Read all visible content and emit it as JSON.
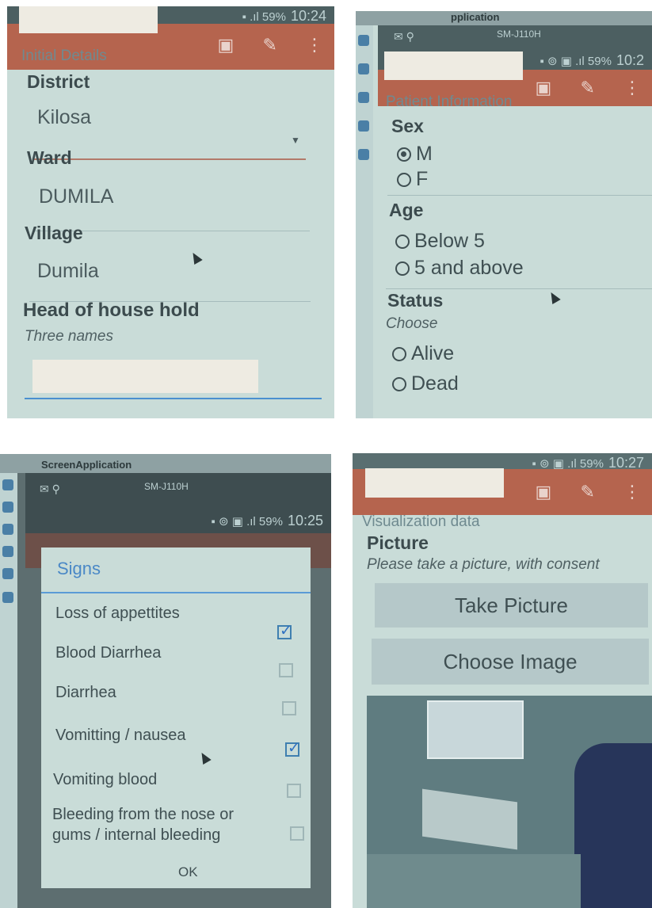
{
  "panel1": {
    "time": "10:24",
    "status_icons": "▪ .ıl 59%",
    "section_title": "Initial Details",
    "district_label": "District",
    "district_value": "Kilosa",
    "ward_label": "Ward",
    "ward_value": "DUMILA",
    "village_label": "Village",
    "village_value": "Dumila",
    "head_label": "Head of house hold",
    "head_hint": "Three names"
  },
  "panel2": {
    "window_title": "pplication",
    "device": "SM-J110H",
    "time": "10:2",
    "status_icons": "▪ ⊚ ▣ .ıl 59%",
    "section_title": "Patient Information",
    "sex_label": "Sex",
    "sex_options": [
      "M",
      "F"
    ],
    "sex_selected": "M",
    "age_label": "Age",
    "age_options": [
      "Below 5",
      "5 and above"
    ],
    "status_label": "Status",
    "status_hint": "Choose",
    "status_options": [
      "Alive",
      "Dead"
    ]
  },
  "panel3": {
    "window_title": "ScreenApplication",
    "device": "SM-J110H",
    "time": "10:25",
    "status_icons": "▪ ⊚ ▣ .ıl 59%",
    "dialog_title": "Signs",
    "items": [
      {
        "label": "Loss of appettites",
        "checked": true
      },
      {
        "label": "Blood Diarrhea",
        "checked": false
      },
      {
        "label": "Diarrhea",
        "checked": false
      },
      {
        "label": "Vomitting / nausea",
        "checked": true
      },
      {
        "label": "Vomiting blood",
        "checked": false
      },
      {
        "label": "Bleeding from the nose or gums / internal bleeding",
        "checked": false
      }
    ],
    "ok_label": "OK"
  },
  "panel4": {
    "time": "10:27",
    "status_icons": "▪ ⊚ ▣ .ıl 59%",
    "section_title": "Visualization data",
    "picture_label": "Picture",
    "picture_hint": "Please take a picture, with consent",
    "take_picture_label": "Take Picture",
    "choose_image_label": "Choose Image"
  },
  "colors": {
    "toolbar": "#b5644e",
    "accent": "#2f71c2",
    "background": "#c9dcd8"
  }
}
